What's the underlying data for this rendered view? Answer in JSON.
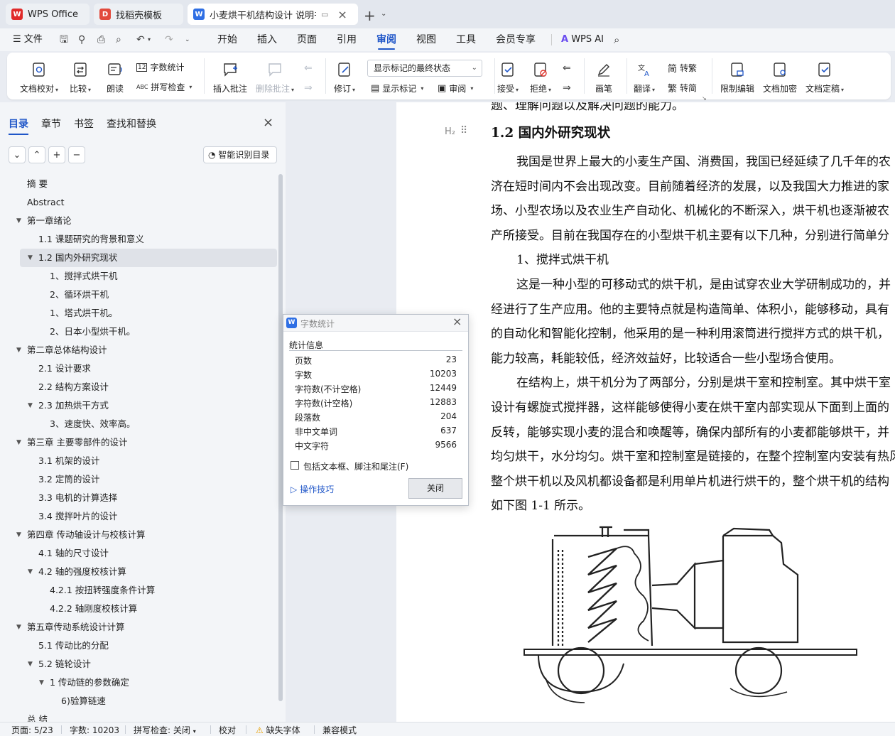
{
  "tabs": {
    "wps": "WPS Office",
    "template": "找稻壳模板",
    "doc": "小麦烘干机结构设计 说明书（"
  },
  "menu": {
    "file": "文件",
    "items": [
      "开始",
      "插入",
      "页面",
      "引用",
      "审阅",
      "视图",
      "工具",
      "会员专享"
    ],
    "selected": "审阅",
    "ai": "WPS AI"
  },
  "ribbon": {
    "doc_check": "文档校对",
    "compare": "比较",
    "read_aloud": "朗读",
    "word_count": "字数统计",
    "spell_check": "拼写检查",
    "insert_comment": "插入批注",
    "delete_comment": "删除批注",
    "track_changes": "修订",
    "display_mode": "显示标记的最终状态",
    "show_markup": "显示标记",
    "review": "审阅",
    "accept": "接受",
    "reject": "拒绝",
    "pen": "画笔",
    "translate": "翻译",
    "to_traditional": "转繁",
    "to_simplified": "转简",
    "restrict_edit": "限制编辑",
    "encrypt": "文档加密",
    "finalize": "文档定稿"
  },
  "nav": {
    "tabs": [
      "目录",
      "章节",
      "书签",
      "查找和替换"
    ],
    "smart_toc": "智能识别目录",
    "toc": [
      {
        "text": "摘 要"
      },
      {
        "text": "Abstract"
      },
      {
        "text": "第一章绪论"
      },
      {
        "text": "1.1 课题研究的背景和意义"
      },
      {
        "text": "1.2 国内外研究现状"
      },
      {
        "text": "1、搅拌式烘干机"
      },
      {
        "text": "2、循环烘干机"
      },
      {
        "text": "1、塔式烘干机。"
      },
      {
        "text": "2、日本小型烘干机。"
      },
      {
        "text": "第二章总体结构设计"
      },
      {
        "text": "2.1 设计要求"
      },
      {
        "text": "2.2 结构方案设计"
      },
      {
        "text": "2.3 加热烘干方式"
      },
      {
        "text": "3、速度快、效率高。"
      },
      {
        "text": "第三章 主要零部件的设计"
      },
      {
        "text": "3.1 机架的设计"
      },
      {
        "text": "3.2 定筒的设计"
      },
      {
        "text": "3.3 电机的计算选择"
      },
      {
        "text": "3.4 搅拌叶片的设计"
      },
      {
        "text": "第四章 传动轴设计与校核计算"
      },
      {
        "text": "4.1 轴的尺寸设计"
      },
      {
        "text": "4.2 轴的强度校核计算"
      },
      {
        "text": "4.2.1 按扭转强度条件计算"
      },
      {
        "text": "4.2.2 轴刚度校核计算"
      },
      {
        "text": "第五章传动系统设计计算"
      },
      {
        "text": "5.1 传动比的分配"
      },
      {
        "text": "5.2 链轮设计"
      },
      {
        "text": "1 传动链的参数确定"
      },
      {
        "text": "6)验算链速"
      },
      {
        "text": "总 结"
      }
    ]
  },
  "document": {
    "top_partial": "题、理解问题以及解决问题的能力。",
    "heading_mark": "H₂",
    "heading": "1.2  国内外研究现状",
    "lines": [
      "我国是世界上最大的小麦生产国、消费国，我国已经延续了几千年的农",
      "济在短时间内不会出现改变。目前随着经济的发展，以及我国大力推进的家",
      "场、小型农场以及农业生产自动化、机械化的不断深入，烘干机也逐渐被农",
      "产所接受。目前在我国存在的小型烘干机主要有以下几种，分别进行简单分",
      "1、搅拌式烘干机",
      "这是一种小型的可移动式的烘干机，是由试穿农业大学研制成功的，并",
      "经进行了生产应用。他的主要特点就是构造简单、体积小，能够移动，具有",
      "的自动化和智能化控制，他采用的是一种利用滚筒进行搅拌方式的烘干机，",
      "能力较高，耗能较低，经济效益好，比较适合一些小型场合使用。",
      "在结构上，烘干机分为了两部分，分别是烘干室和控制室。其中烘干室",
      "设计有螺旋式搅拌器，这样能够使得小麦在烘干室内部实现从下面到上面的",
      "反转，能够实现小麦的混合和唤醒等，确保内部所有的小麦都能够烘干，并",
      "均匀烘干，水分均匀。烘干室和控制室是链接的，在整个控制室内安装有热风",
      "整个烘干机以及风机都设备都是利用单片机进行烘干的，整个烘干机的结构",
      "如下图 1-1 所示。"
    ]
  },
  "dialog": {
    "title": "字数统计",
    "section": "统计信息",
    "stats": [
      {
        "label": "页数",
        "value": "23"
      },
      {
        "label": "字数",
        "value": "10203"
      },
      {
        "label": "字符数(不计空格)",
        "value": "12449"
      },
      {
        "label": "字符数(计空格)",
        "value": "12883"
      },
      {
        "label": "段落数",
        "value": "204"
      },
      {
        "label": "非中文单词",
        "value": "637"
      },
      {
        "label": "中文字符",
        "value": "9566"
      }
    ],
    "include_label": "包括文本框、脚注和尾注(F)",
    "include_checked": false,
    "tips": "操作技巧",
    "close": "关闭"
  },
  "status": {
    "page": "页面: 5/23",
    "words": "字数: 10203",
    "spell": "拼写检查: 关闭",
    "proof": "校对",
    "missing_font": "缺失字体",
    "compat": "兼容模式"
  },
  "colors": {
    "accent": "#1f56c8",
    "wps_red": "#e02b2b"
  }
}
